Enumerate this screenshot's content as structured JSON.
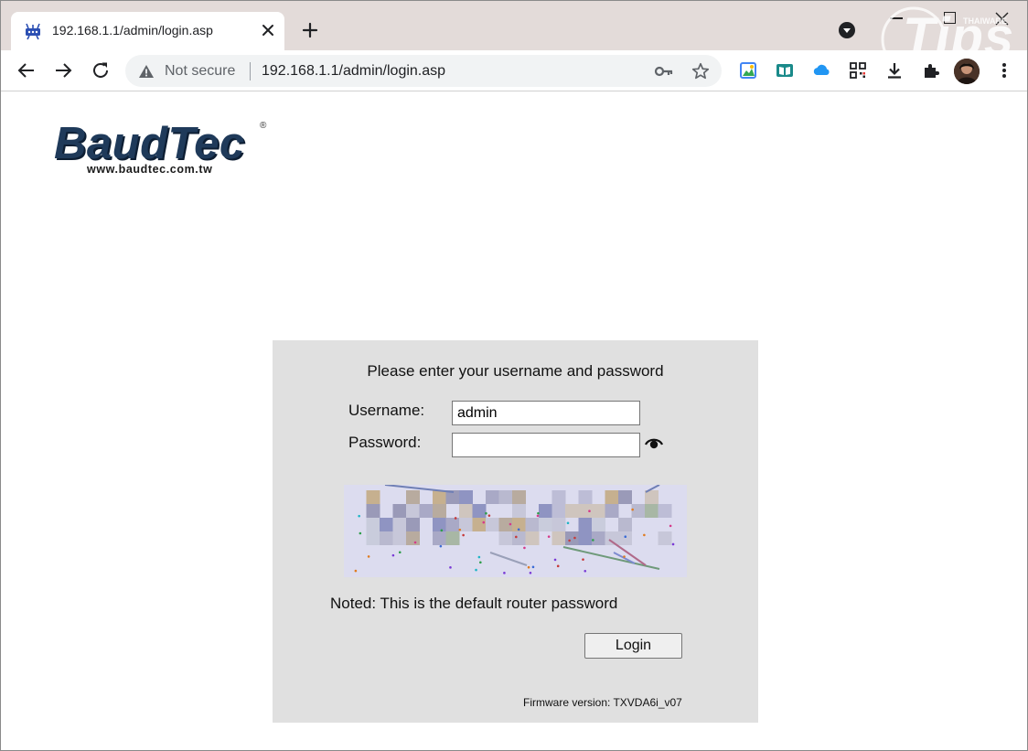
{
  "browser": {
    "tab": {
      "title": "192.168.1.1/admin/login.asp"
    },
    "omnibox": {
      "security_label": "Not secure",
      "url": "192.168.1.1/admin/login.asp"
    },
    "icons": {
      "favicon": "router-favicon-icon",
      "close_tab": "close-icon",
      "new_tab": "plus-icon",
      "tab_search": "chevron-down-circle-icon",
      "back": "arrow-left-icon",
      "forward": "arrow-right-icon",
      "reload": "reload-icon",
      "warning": "warning-triangle-icon",
      "password_key": "key-icon",
      "bookmark": "star-icon",
      "extensions": [
        "image-extension-icon",
        "reader-extension-icon",
        "cloud-extension-icon",
        "qr-code-icon",
        "download-icon",
        "puzzle-icon"
      ],
      "menu": "kebab-menu-icon"
    },
    "accent": "#1a73e8"
  },
  "watermark": {
    "text": "Tips",
    "small_text": "THAIWARE"
  },
  "logo": {
    "brand": "BaudTec",
    "registered": "®",
    "website": "www.baudtec.com.tw",
    "color": "#1f3a5a"
  },
  "login": {
    "prompt": "Please enter your username and password",
    "username_label": "Username:",
    "username_value": "admin",
    "password_label": "Password:",
    "password_value": "",
    "note": "Noted: This is the default router password",
    "login_button": "Login",
    "firmware": "Firmware version: TXVDA6i_v07",
    "panel_color": "#e0e0e0"
  }
}
